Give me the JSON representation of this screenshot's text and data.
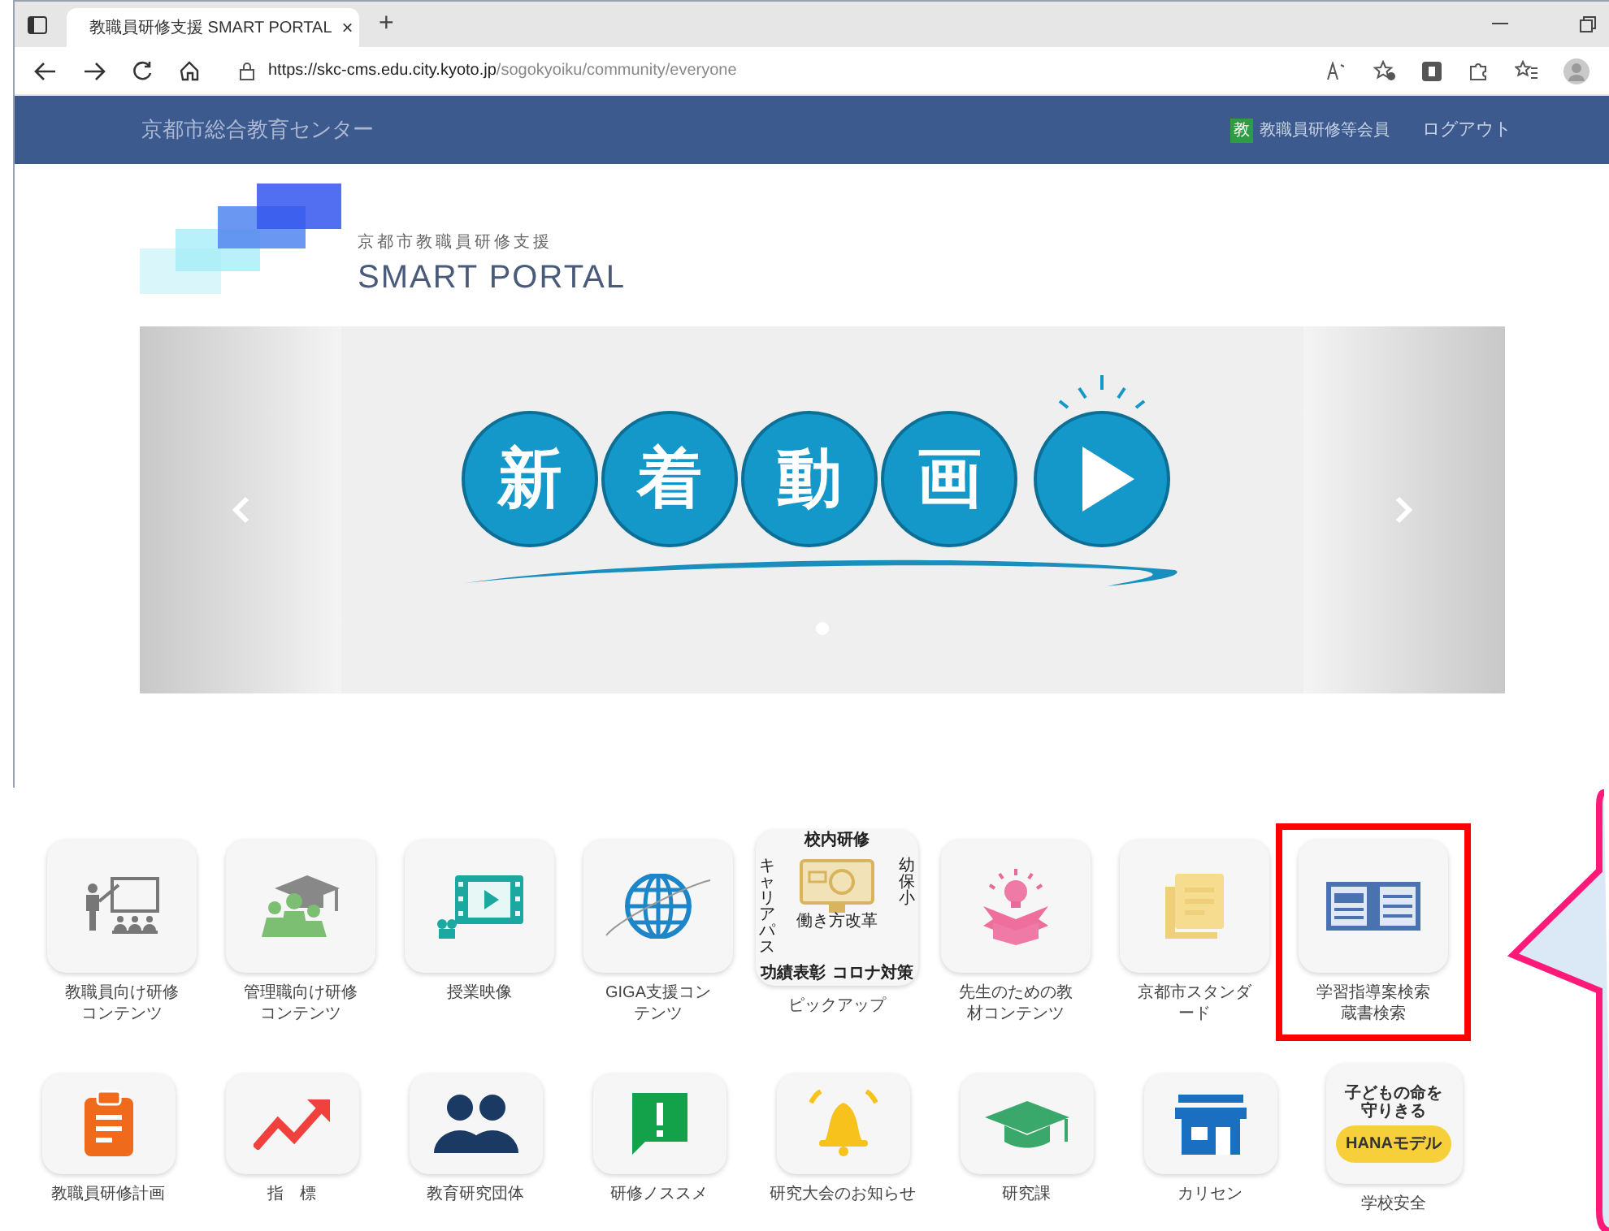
{
  "browser": {
    "tab_title": "教職員研修支援 SMART PORTAL",
    "tab_close": "×",
    "new_tab": "+",
    "url_host": "https://skc-cms.edu.city.kyoto.jp",
    "url_path": "/sogokyoiku/community/everyone"
  },
  "header": {
    "site_title": "京都市総合教育センター",
    "member_badge": "教",
    "member_label": "教職員研修等会員",
    "logout": "ログアウト"
  },
  "logo": {
    "tagline": "京都市教職員研修支援",
    "name": "SMART PORTAL"
  },
  "carousel": {
    "banner_chars": [
      "新",
      "着",
      "動",
      "画"
    ],
    "dots": [
      {
        "selected": true
      }
    ]
  },
  "menu_rows": [
    [
      {
        "kind": "icon",
        "label": "教職員向け研修コンテンツ",
        "highlighted": false
      },
      {
        "kind": "icon",
        "label": "管理職向け研修コンテンツ",
        "highlighted": false
      },
      {
        "kind": "icon",
        "label": "授業映像",
        "highlighted": false
      },
      {
        "kind": "icon",
        "label": "GIGA支援コンテンツ",
        "highlighted": false
      },
      {
        "kind": "pickup",
        "label": "ピックアップ",
        "highlighted": false,
        "tile_texts": [
          "校内研修",
          "キャリアパス",
          "幼保小",
          "働き方改革",
          "功績表彰",
          "コロナ対策"
        ]
      },
      {
        "kind": "icon",
        "label": "先生のための教材コンテンツ",
        "highlighted": false
      },
      {
        "kind": "icon",
        "label": "京都市スタンダード",
        "highlighted": false
      },
      {
        "kind": "icon",
        "label": "学習指導案検索蔵書検索",
        "highlighted": true
      }
    ],
    [
      {
        "kind": "icon",
        "label": "教職員研修計画",
        "highlighted": false
      },
      {
        "kind": "icon",
        "label": "指　標",
        "highlighted": false
      },
      {
        "kind": "icon",
        "label": "教育研究団体",
        "highlighted": false
      },
      {
        "kind": "icon",
        "label": "研修ノススメ",
        "highlighted": false
      },
      {
        "kind": "icon",
        "label": "研究大会のお知らせ",
        "highlighted": false
      },
      {
        "kind": "icon",
        "label": "研究課",
        "highlighted": false
      },
      {
        "kind": "icon",
        "label": "カリセン",
        "highlighted": false
      },
      {
        "kind": "badge",
        "label": "学校安全",
        "highlighted": false,
        "tile_texts": [
          "子どもの命を守りきる",
          "HANAモデル"
        ]
      }
    ]
  ]
}
